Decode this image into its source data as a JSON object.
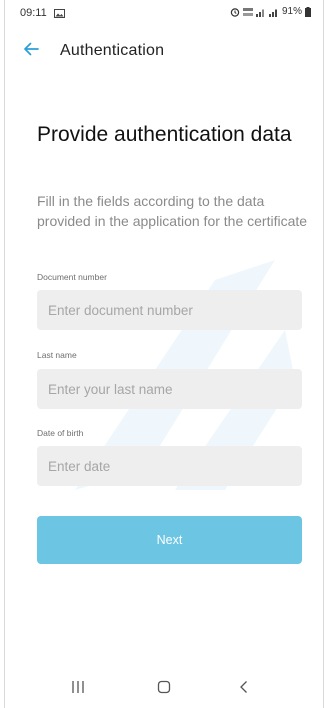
{
  "status_bar": {
    "time": "09:11",
    "battery": "91%",
    "icons": [
      "image-icon",
      "alarm-icon",
      "lte-icon",
      "signal-icon",
      "signal-icon",
      "battery-icon"
    ]
  },
  "app_bar": {
    "title": "Authentication",
    "back_icon": "arrow-left-icon"
  },
  "main": {
    "heading": "Provide authentication data",
    "subtext": "Fill in the fields according to the data provided in the application for the certificate",
    "fields": [
      {
        "label": "Document number",
        "placeholder": "Enter document number",
        "value": ""
      },
      {
        "label": "Last name",
        "placeholder": "Enter your last name",
        "value": ""
      },
      {
        "label": "Date of birth",
        "placeholder": "Enter date",
        "value": ""
      }
    ],
    "next_label": "Next"
  },
  "nav_bar": {
    "icons": [
      "recent-apps-icon",
      "home-icon",
      "back-icon"
    ]
  },
  "colors": {
    "accent": "#2b9fd9",
    "button": "#6cc6e3",
    "input_bg": "#eeeeee"
  }
}
